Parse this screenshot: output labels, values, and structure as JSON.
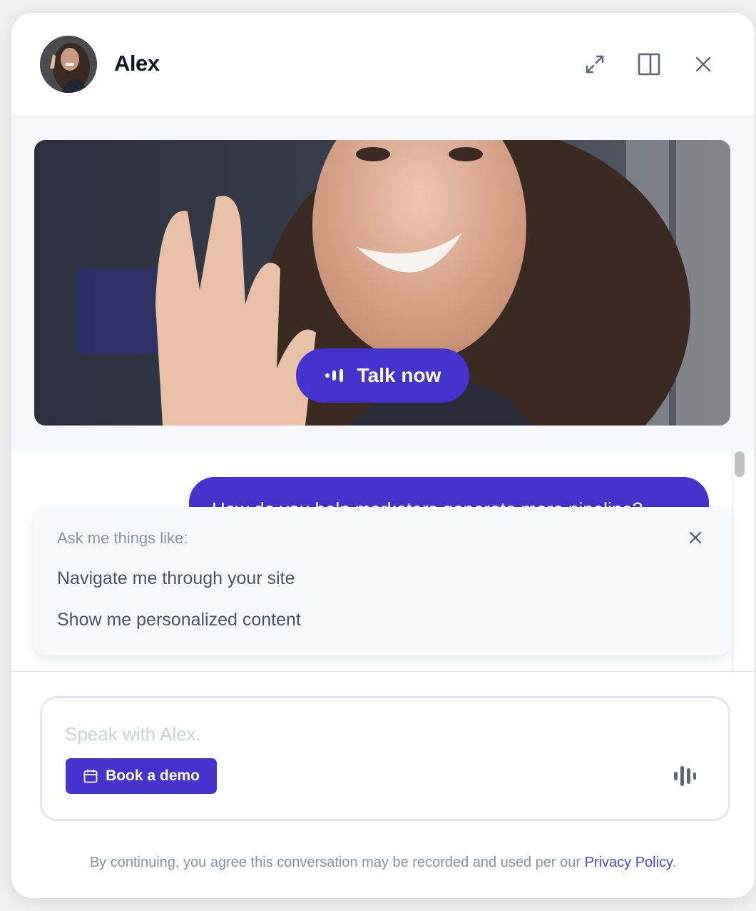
{
  "header": {
    "agent_name": "Alex",
    "icons": [
      "expand-icon",
      "side-panel-icon",
      "close-icon"
    ]
  },
  "video": {
    "talk_button_label": "Talk now"
  },
  "chat": {
    "user_message": "How do you help marketers generate more pipeline?"
  },
  "suggestions": {
    "title": "Ask me things like:",
    "items": [
      "Navigate me through your site",
      "Show me personalized content"
    ]
  },
  "composer": {
    "placeholder": "Speak with Alex.",
    "book_demo_label": "Book a demo"
  },
  "footer": {
    "disclaimer_prefix": "By continuing, you agree this conversation may be recorded and used per our",
    "privacy_link": "Privacy Policy",
    "disclaimer_suffix": "."
  },
  "colors": {
    "accent": "#4433cc",
    "link": "#4b48d6",
    "muted_text": "#8492a6"
  }
}
